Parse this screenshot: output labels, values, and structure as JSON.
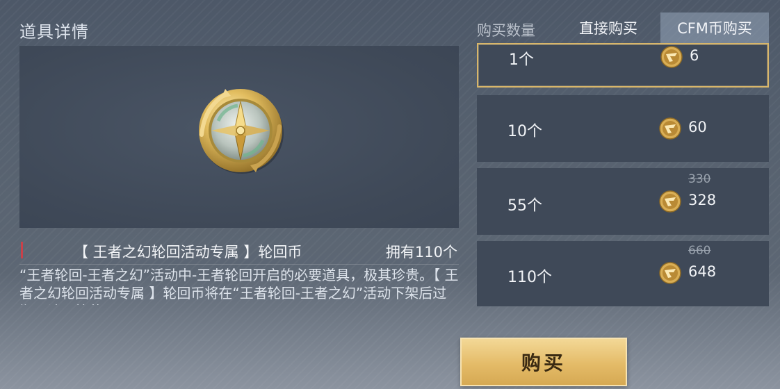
{
  "panel": {
    "title": "道具详情"
  },
  "item": {
    "name": "【 王者之幻轮回活动专属 】轮回币",
    "owned": "拥有110个",
    "description": "“王者轮回-王者之幻”活动中-王者轮回开启的必要道具，极其珍贵。【 王者之幻轮回活动专属 】轮回币将在“王者轮回-王者之幻”活动下架后过期，请尽快使用。",
    "icon": "compass-coin-icon"
  },
  "tabs": {
    "quantity_label": "购买数量",
    "direct": "直接购买",
    "cfm": "CFM币购买",
    "active": "cfm"
  },
  "options": [
    {
      "qty": "1个",
      "price": "6",
      "original": "",
      "selected": true
    },
    {
      "qty": "10个",
      "price": "60",
      "original": "",
      "selected": false
    },
    {
      "qty": "55个",
      "price": "328",
      "original": "330",
      "selected": false
    },
    {
      "qty": "110个",
      "price": "648",
      "original": "660",
      "selected": false
    }
  ],
  "currency_icon": "cfm-coin-icon",
  "buy_button": {
    "label": "购买"
  },
  "colors": {
    "accent_gold": "#d8b66a",
    "name_marker": "#c8414a"
  }
}
